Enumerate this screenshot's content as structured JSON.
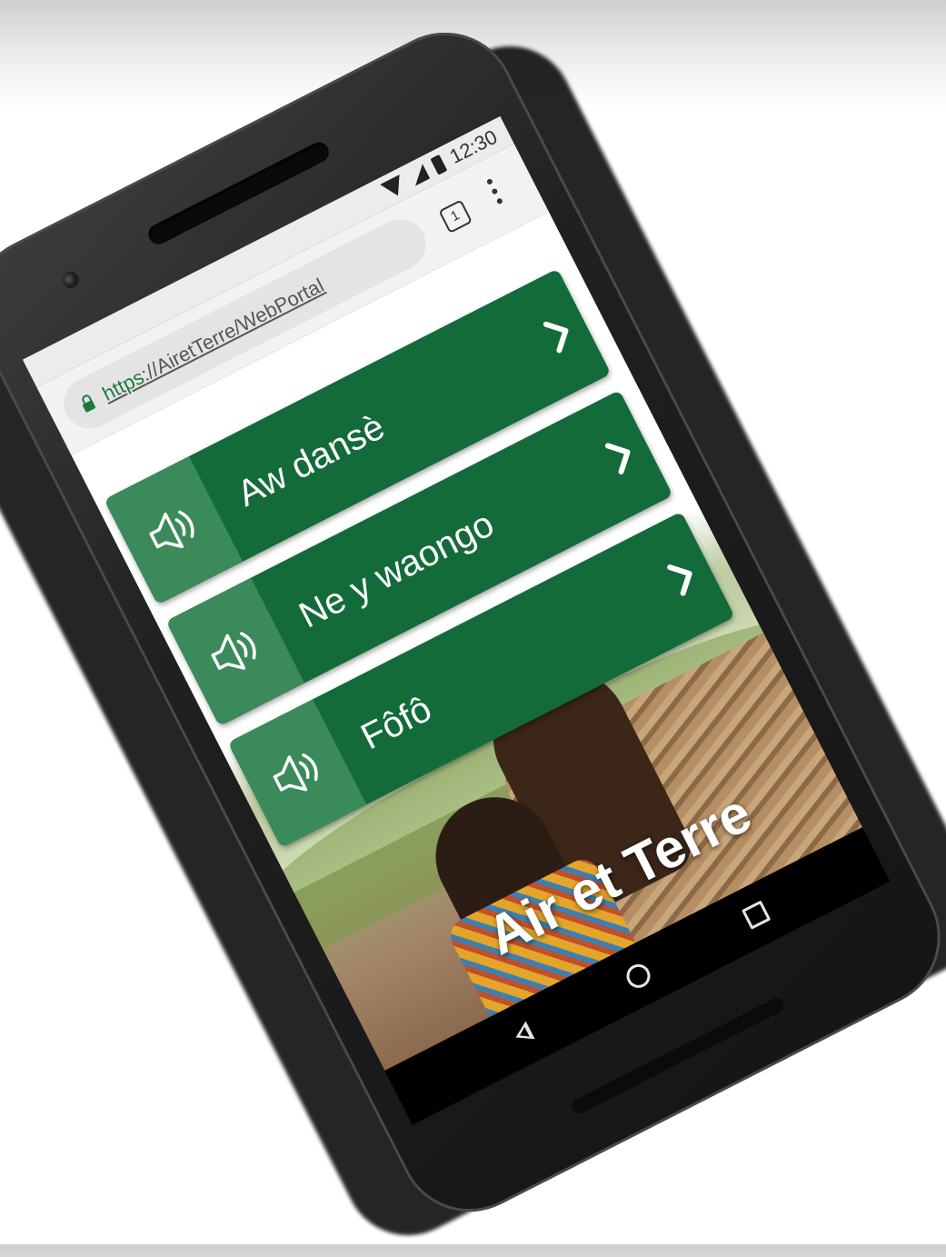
{
  "status_bar": {
    "time": "12:30"
  },
  "browser": {
    "url_scheme": "https",
    "url_rest": "://AiretTerre/WebPortal",
    "tab_count": "1"
  },
  "buttons": [
    {
      "label": "Aw dansè"
    },
    {
      "label": "Ne y waongo"
    },
    {
      "label": "Fôfô"
    }
  ],
  "hero": {
    "title": "Air et Terre"
  },
  "colors": {
    "button_green": "#146b3a",
    "audio_panel_green": "#3b8a5a",
    "lock_green": "#1b7a3a"
  },
  "icons": {
    "audio": "speaker-icon",
    "chevron": "chevron-right-icon",
    "lock": "lock-icon",
    "menu": "more-vert-icon",
    "back": "nav-back-icon",
    "home": "nav-home-icon",
    "recents": "nav-recents-icon"
  }
}
